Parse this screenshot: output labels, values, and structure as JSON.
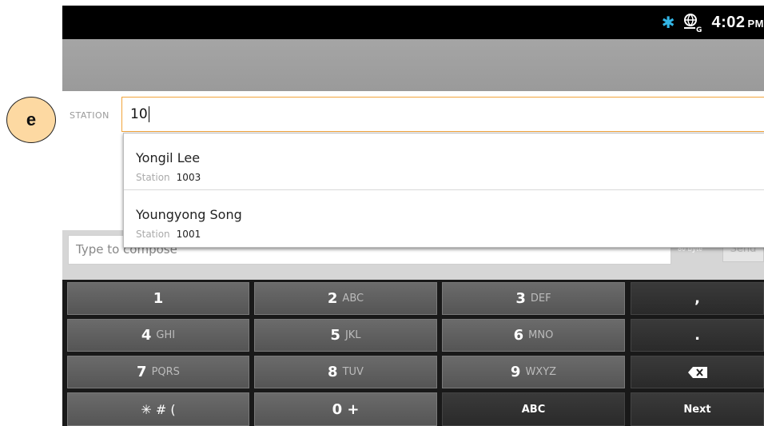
{
  "annotation": {
    "letter": "e"
  },
  "status_bar": {
    "icons": [
      "bluetooth-icon",
      "network-globe-icon"
    ],
    "time": "4:02",
    "ampm": "PM"
  },
  "station": {
    "label": "STATION",
    "value": "10"
  },
  "suggestions": [
    {
      "name": "Yongil Lee",
      "station_label": "Station",
      "station": "1003"
    },
    {
      "name": "Youngyong Song",
      "station_label": "Station",
      "station": "1001"
    }
  ],
  "compose": {
    "placeholder": "Type to compose",
    "byte_count": "80 byte",
    "send_label": "Send"
  },
  "keypad": {
    "rows": [
      [
        {
          "main": "1",
          "sub": ""
        },
        {
          "main": "2",
          "sub": "ABC"
        },
        {
          "main": "3",
          "sub": "DEF"
        },
        {
          "main": ",",
          "sub": ""
        }
      ],
      [
        {
          "main": "4",
          "sub": "GHI"
        },
        {
          "main": "5",
          "sub": "JKL"
        },
        {
          "main": "6",
          "sub": "MNO"
        },
        {
          "main": ".",
          "sub": ""
        }
      ],
      [
        {
          "main": "7",
          "sub": "PQRS"
        },
        {
          "main": "8",
          "sub": "TUV"
        },
        {
          "main": "9",
          "sub": "WXYZ"
        },
        {
          "main": "",
          "sub": ""
        }
      ],
      [
        {
          "main": "✳ # (",
          "sub": ""
        },
        {
          "main": "0 +",
          "sub": ""
        },
        {
          "main": "ABC",
          "sub": ""
        },
        {
          "main": "Next",
          "sub": ""
        }
      ]
    ],
    "backspace_icon": "backspace-icon"
  },
  "colors": {
    "focus_border": "#f2a43a",
    "bluetooth": "#33b5e5",
    "annotation_fill": "#fdd9a2"
  }
}
